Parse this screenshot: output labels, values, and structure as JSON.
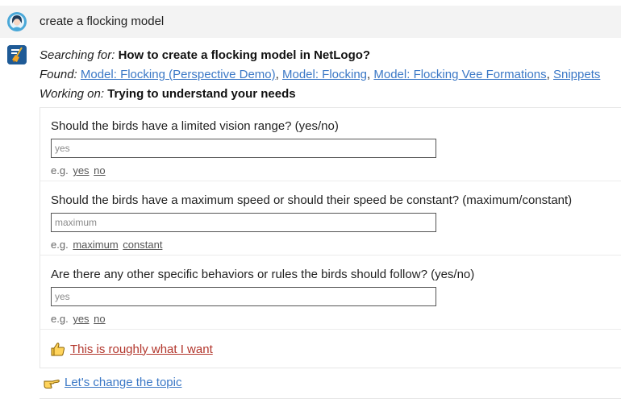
{
  "user": {
    "message": "create a flocking model"
  },
  "assistant": {
    "searching_label": "Searching for:",
    "searching_query": "How to create a flocking model in NetLogo?",
    "found_label": "Found:",
    "found_links": [
      "Model: Flocking (Perspective Demo)",
      "Model: Flocking",
      "Model: Flocking Vee Formations",
      "Snippets"
    ],
    "working_label": "Working on:",
    "working_text": "Trying to understand your needs"
  },
  "questions": [
    {
      "text": "Should the birds have a limited vision range? (yes/no)",
      "placeholder": "yes",
      "eg_label": "e.g.",
      "examples": [
        "yes",
        "no"
      ]
    },
    {
      "text": "Should the birds have a maximum speed or should their speed be constant? (maximum/constant)",
      "placeholder": "maximum",
      "eg_label": "e.g.",
      "examples": [
        "maximum",
        "constant"
      ]
    },
    {
      "text": "Are there any other specific behaviors or rules the birds should follow? (yes/no)",
      "placeholder": "yes",
      "eg_label": "e.g.",
      "examples": [
        "yes",
        "no"
      ]
    }
  ],
  "actions": {
    "approve_label": "This is roughly what I want",
    "change_topic_label": "Let's change the topic"
  },
  "icons": {
    "user_avatar": "user-avatar-icon",
    "bot_avatar": "assistant-broom-icon",
    "approve": "thumbs-up-icon",
    "change_topic": "pointing-hand-icon"
  },
  "colors": {
    "link": "#3b78c6",
    "approve": "#b2352b",
    "user_row_bg": "#f3f3f3"
  }
}
